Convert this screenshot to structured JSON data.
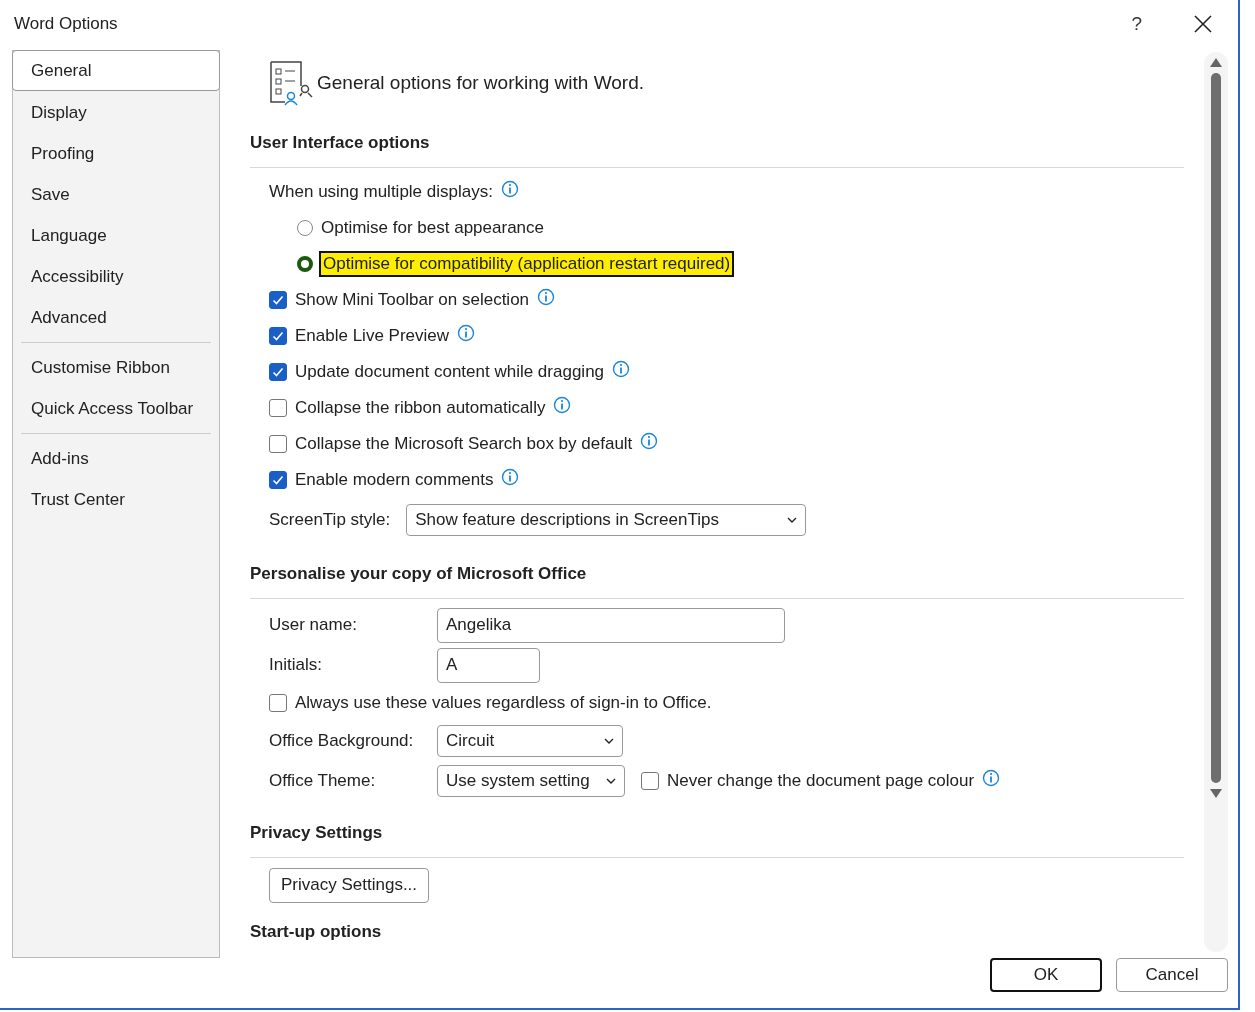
{
  "window": {
    "title": "Word Options",
    "help": "?"
  },
  "sidebar": {
    "groups": [
      [
        {
          "label": "General",
          "selected": true
        },
        {
          "label": "Display",
          "selected": false
        },
        {
          "label": "Proofing",
          "selected": false
        },
        {
          "label": "Save",
          "selected": false
        },
        {
          "label": "Language",
          "selected": false
        },
        {
          "label": "Accessibility",
          "selected": false
        },
        {
          "label": "Advanced",
          "selected": false
        }
      ],
      [
        {
          "label": "Customise Ribbon",
          "selected": false
        },
        {
          "label": "Quick Access Toolbar",
          "selected": false
        }
      ],
      [
        {
          "label": "Add-ins",
          "selected": false
        },
        {
          "label": "Trust Center",
          "selected": false
        }
      ]
    ]
  },
  "header": "General options for working with Word.",
  "sections": [
    {
      "title": "User Interface options",
      "rows": [
        {
          "kind": "text",
          "label": "When using multiple displays:",
          "info": true
        },
        {
          "kind": "radio",
          "label": "Optimise for best appearance",
          "selected": false,
          "highlighted": false
        },
        {
          "kind": "radio",
          "label": "Optimise for compatibility (application restart required)",
          "selected": true,
          "highlighted": true
        },
        {
          "kind": "checkbox",
          "label": "Show Mini Toolbar on selection",
          "checked": true,
          "info": true
        },
        {
          "kind": "checkbox",
          "label": "Enable Live Preview",
          "checked": true,
          "info": true
        },
        {
          "kind": "checkbox",
          "label": "Update document content while dragging",
          "checked": true,
          "info": true
        },
        {
          "kind": "checkbox",
          "label": "Collapse the ribbon automatically",
          "checked": false,
          "info": true
        },
        {
          "kind": "checkbox",
          "label": "Collapse the Microsoft Search box by default",
          "checked": false,
          "info": true
        },
        {
          "kind": "checkbox",
          "label": "Enable modern comments",
          "checked": true,
          "info": true
        },
        {
          "kind": "inline_dropdown",
          "label": "ScreenTip style:",
          "value": "Show feature descriptions in ScreenTips"
        }
      ]
    },
    {
      "title": "Personalise your copy of Microsoft Office",
      "rows": [
        {
          "kind": "field",
          "label": "User name:",
          "value": "Angelika"
        },
        {
          "kind": "field",
          "label": "Initials:",
          "value": "A"
        },
        {
          "kind": "checkbox",
          "label": "Always use these values regardless of sign-in to Office.",
          "checked": false,
          "info": false
        },
        {
          "kind": "dropdown",
          "label": "Office Background:",
          "value": "Circuit"
        },
        {
          "kind": "dropdown",
          "label": "Office Theme:",
          "value": "Use system setting",
          "extra": {
            "label": "Never change the document page colour",
            "checked": false,
            "info": true
          }
        }
      ]
    },
    {
      "title": "Privacy Settings",
      "rows": [
        {
          "kind": "button",
          "label": "Privacy Settings..."
        }
      ]
    },
    {
      "title": "Start-up options"
    }
  ],
  "buttons": [
    {
      "label": "OK",
      "default": true
    },
    {
      "label": "Cancel",
      "default": false
    }
  ]
}
